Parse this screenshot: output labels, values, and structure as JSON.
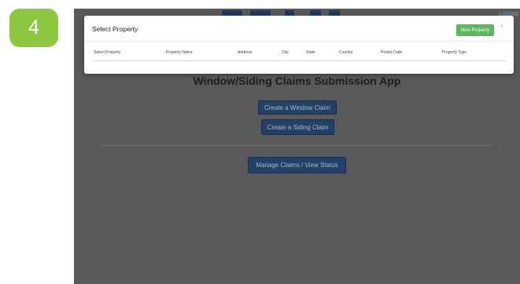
{
  "step": {
    "number": "4"
  },
  "app": {
    "logout": "Logout",
    "title": "Window/Siding Claims Submission App",
    "buttons": {
      "create_window": "Create a Window Claim",
      "create_siding": "Create a Siding Claim",
      "manage": "Manage Claims / View Status"
    }
  },
  "modal": {
    "title": "Select Property",
    "new_property": "New Property",
    "close": "×",
    "columns": [
      "Select Property",
      "Property Name",
      "Address",
      "City",
      "State",
      "Country",
      "Postal Code",
      "Property Type"
    ]
  },
  "colors": {
    "badge": "#8dc63f",
    "overlay": "#58595b",
    "primary_button": "#244066",
    "success_button": "#5cb85c"
  }
}
